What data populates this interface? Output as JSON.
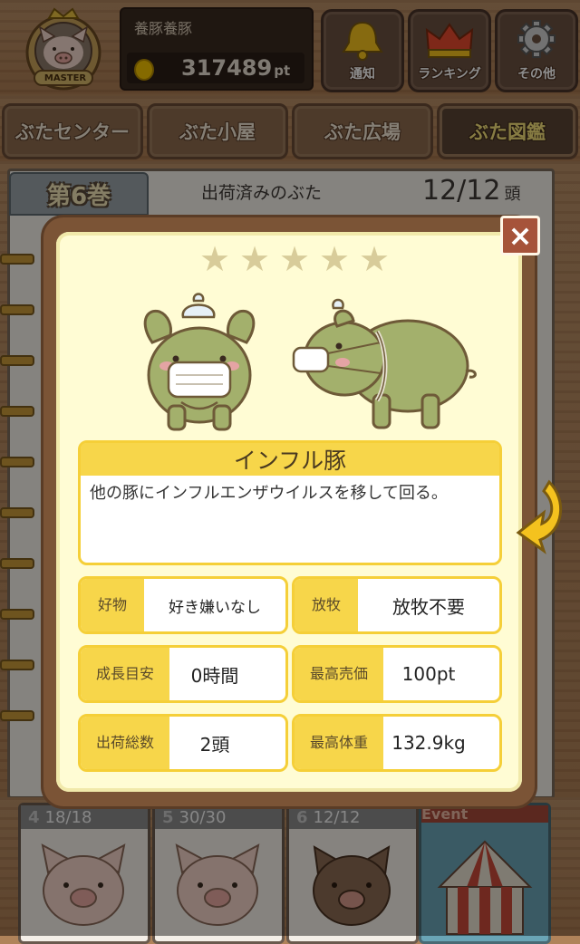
{
  "header": {
    "badge_text": "MASTER",
    "user_name": "養豚養豚",
    "points": "317489",
    "points_unit": "pt",
    "buttons": [
      {
        "label": "通知",
        "icon": "bell-icon"
      },
      {
        "label": "ランキング",
        "icon": "crown-icon"
      },
      {
        "label": "その他",
        "icon": "gear-icon"
      }
    ]
  },
  "nav": {
    "tabs": [
      "ぶたセンター",
      "ぶた小屋",
      "ぶた広場",
      "ぶた図鑑"
    ],
    "active": "ぶた図鑑"
  },
  "book": {
    "volume_label": "第6巻",
    "title": "出荷済みのぶた",
    "count": "12/12",
    "count_unit": "頭"
  },
  "modal": {
    "close_label": "×",
    "rating": 5,
    "pig_name": "インフル豚",
    "description": "他の豚にインフルエンザウイルスを移して回る。",
    "info": [
      {
        "label": "好物",
        "value": "好き嫌いなし"
      },
      {
        "label": "放牧",
        "value": "放牧不要"
      },
      {
        "label": "成長目安",
        "value": "0時間"
      },
      {
        "label": "最高売価",
        "value": "100pt"
      },
      {
        "label": "出荷総数",
        "value": "2頭"
      },
      {
        "label": "最高体重",
        "value": "132.9kg"
      }
    ]
  },
  "bottom_volumes": [
    {
      "number": "4",
      "count": "18/18"
    },
    {
      "number": "5",
      "count": "30/30"
    },
    {
      "number": "6",
      "count": "12/12"
    }
  ],
  "event_label": "Event",
  "colors": {
    "modal_frame": "#7b5436",
    "modal_bg": "#fffcd4",
    "accent_yellow": "#f7d64a",
    "pig_green": "#a3b06c"
  }
}
